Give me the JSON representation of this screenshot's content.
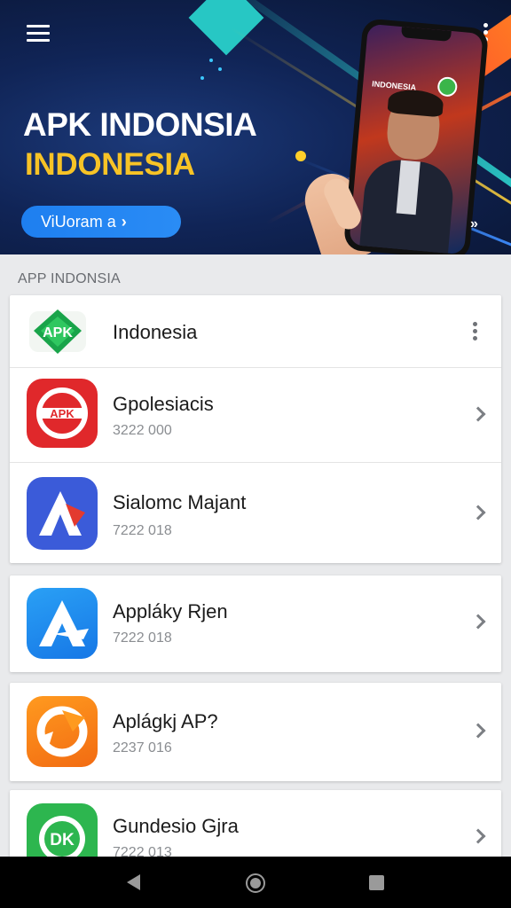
{
  "banner": {
    "title": "APK INDONSIA",
    "subtitle": "INDONESIA",
    "cta_label": "ViUoram a",
    "cta_arrow": "›",
    "phone_screen_text": "INDONESIA",
    "side_arrow": "»"
  },
  "section": {
    "label": "APP INDONSIA"
  },
  "apps": [
    {
      "name": "Indonesia",
      "meta": "",
      "icon": "apk-green-badge-icon",
      "trailing": "more-vert-icon"
    },
    {
      "name": "Gpolesiacis",
      "meta": "3222 000",
      "icon": "apk-red-icon",
      "trailing": "chevron-right-icon"
    },
    {
      "name": "Sialomc Majant",
      "meta": "7222 018",
      "icon": "a-blue-red-icon",
      "trailing": "chevron-right-icon"
    },
    {
      "name": "Appláky Rjen",
      "meta": "7222 018",
      "icon": "a-blue-icon",
      "trailing": "chevron-right-icon"
    },
    {
      "name": "Aplágkj AP?",
      "meta": "2237 016",
      "icon": "orange-swirl-icon",
      "trailing": "chevron-right-icon"
    },
    {
      "name": "Gundesio Gjra",
      "meta": "7222 013",
      "icon": "dk-green-icon",
      "trailing": "chevron-right-icon"
    }
  ],
  "colors": {
    "banner_bg": "#102456",
    "accent_yellow": "#f7c326",
    "cta_blue": "#1e7ff0",
    "page_bg": "#e9eaec"
  }
}
